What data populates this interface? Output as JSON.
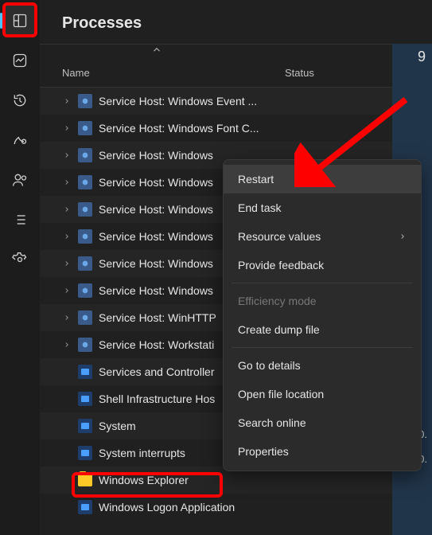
{
  "header": {
    "title": "Processes"
  },
  "columns": {
    "name": "Name",
    "status": "Status",
    "right": "9"
  },
  "sidebar_items": [
    "processes",
    "performance",
    "history",
    "startup",
    "users",
    "details",
    "services"
  ],
  "processes": [
    {
      "expandable": true,
      "icon": "gear",
      "label": "Service Host: Windows Event ..."
    },
    {
      "expandable": true,
      "icon": "gear",
      "label": "Service Host: Windows Font C..."
    },
    {
      "expandable": true,
      "icon": "gear",
      "label": "Service Host: Windows"
    },
    {
      "expandable": true,
      "icon": "gear",
      "label": "Service Host: Windows"
    },
    {
      "expandable": true,
      "icon": "gear",
      "label": "Service Host: Windows"
    },
    {
      "expandable": true,
      "icon": "gear",
      "label": "Service Host: Windows"
    },
    {
      "expandable": true,
      "icon": "gear",
      "label": "Service Host: Windows"
    },
    {
      "expandable": true,
      "icon": "gear",
      "label": "Service Host: Windows"
    },
    {
      "expandable": true,
      "icon": "gear",
      "label": "Service Host: WinHTTP"
    },
    {
      "expandable": true,
      "icon": "gear",
      "label": "Service Host: Workstati"
    },
    {
      "expandable": false,
      "icon": "svc",
      "label": "Services and Controller"
    },
    {
      "expandable": false,
      "icon": "svc",
      "label": "Shell Infrastructure Hos"
    },
    {
      "expandable": false,
      "icon": "svc",
      "label": "System"
    },
    {
      "expandable": false,
      "icon": "svc",
      "label": "System interrupts"
    },
    {
      "expandable": false,
      "icon": "folder",
      "label": "Windows Explorer"
    },
    {
      "expandable": false,
      "icon": "svc",
      "label": "Windows Logon Application"
    }
  ],
  "context_menu": [
    {
      "label": "Restart",
      "hover": true
    },
    {
      "label": "End task"
    },
    {
      "label": "Resource values",
      "submenu": true
    },
    {
      "label": "Provide feedback"
    },
    {
      "sep": true
    },
    {
      "label": "Efficiency mode",
      "disabled": true
    },
    {
      "label": "Create dump file"
    },
    {
      "sep": true
    },
    {
      "label": "Go to details"
    },
    {
      "label": "Open file location"
    },
    {
      "label": "Search online"
    },
    {
      "label": "Properties"
    }
  ],
  "pct_vals": [
    "0.",
    "0."
  ]
}
